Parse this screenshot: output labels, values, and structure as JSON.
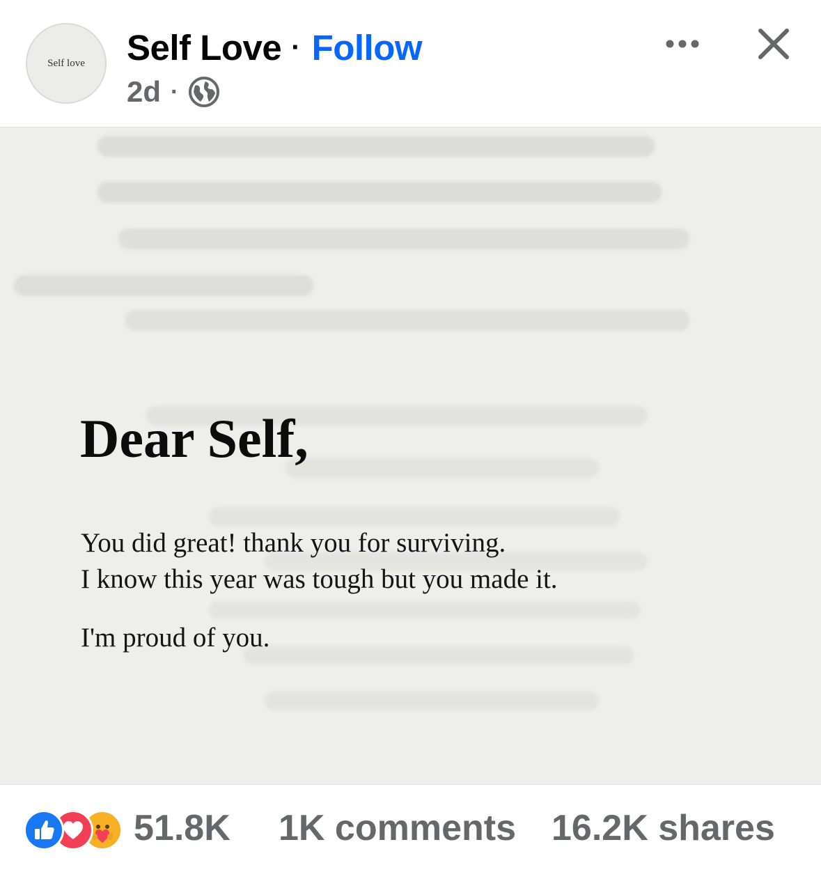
{
  "header": {
    "avatar_text": "Self love",
    "page_name": "Self Love",
    "separator": "·",
    "follow_label": "Follow",
    "time": "2d",
    "meta_separator": "·",
    "privacy_icon": "globe-icon",
    "more_icon": "more-dots-icon",
    "close_icon": "close-icon"
  },
  "post_image": {
    "heading": "Dear Self,",
    "lines": [
      "You did great! thank you for surviving.",
      "I know this year was tough but you made it.",
      "I'm proud of you."
    ]
  },
  "footer": {
    "reaction_icons": [
      "like-icon",
      "love-icon",
      "care-icon"
    ],
    "reaction_count": "51.8K",
    "comments": "1K comments",
    "shares": "16.2K shares"
  },
  "colors": {
    "follow": "#0866ff",
    "secondary_text": "#65676b",
    "like": "#1877f2",
    "love": "#f33e58",
    "care": "#f7b125"
  }
}
